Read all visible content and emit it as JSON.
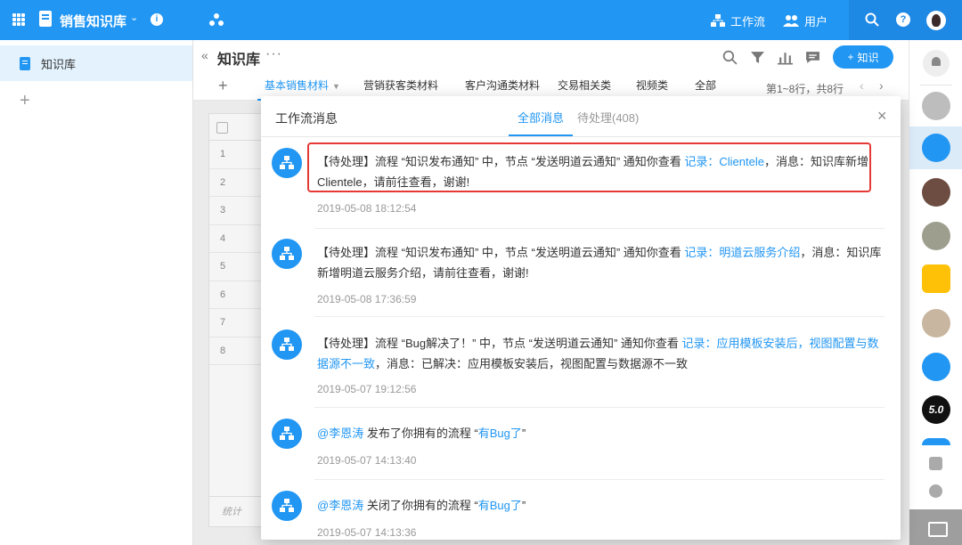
{
  "topbar": {
    "app_title": "销售知识库",
    "workflow_label": "工作流",
    "users_label": "用户",
    "info_glyph": "i",
    "help_glyph": "?"
  },
  "sidebar": {
    "items": [
      {
        "label": "知识库"
      }
    ],
    "add_glyph": "+"
  },
  "main": {
    "title": "知识库",
    "add_button_label": "知识",
    "tabs": [
      {
        "label": "基本销售材料",
        "active": true
      },
      {
        "label": "营销获客类材料"
      },
      {
        "label": "客户沟通类材料"
      },
      {
        "label": "交易相关类"
      },
      {
        "label": "视频类"
      },
      {
        "label": "全部"
      }
    ],
    "pager_text": "第1~8行，共8行",
    "row_numbers": [
      "1",
      "2",
      "3",
      "4",
      "5",
      "6",
      "7",
      "8"
    ],
    "footer_label": "统计"
  },
  "dialog": {
    "title": "工作流消息",
    "tab_all": "全部消息",
    "tab_pending": "待处理(408)",
    "close_glyph": "×",
    "messages": [
      {
        "pre": "【待处理】流程 “知识发布通知” 中，节点 “发送明道云通知” 通知你查看 ",
        "link": "记录：Clientele",
        "post": "，消息：知识库新增Clientele，请前往查看，谢谢!",
        "time": "2019-05-08 18:12:54"
      },
      {
        "pre": "【待处理】流程 “知识发布通知” 中，节点 “发送明道云通知” 通知你查看 ",
        "link": "记录：明道云服务介绍",
        "post": "，消息：知识库新增明道云服务介绍，请前往查看，谢谢!",
        "time": "2019-05-08 17:36:59"
      },
      {
        "pre": "【待处理】流程 “Bug解决了！” 中，节点 “发送明道云通知” 通知你查看 ",
        "link": "记录：应用模板安装后，视图配置与数据源不一致",
        "post": "，消息：已解决：应用模板安装后，视图配置与数据源不一致",
        "time": "2019-05-07 19:12:56"
      },
      {
        "pre": "",
        "mention": "@李恩涛",
        "mid": " 发布了你拥有的流程 “",
        "link": "有Bug了",
        "post": "”",
        "time": "2019-05-07 14:13:40"
      },
      {
        "pre": "",
        "mention": "@李恩涛",
        "mid": " 关闭了你拥有的流程 “",
        "link": "有Bug了",
        "post": "”",
        "time": "2019-05-07 14:13:36"
      }
    ]
  },
  "rail": {
    "version_badge": "5.0"
  },
  "colors": {
    "primary": "#2196f3",
    "highlight_border": "#e53935"
  }
}
